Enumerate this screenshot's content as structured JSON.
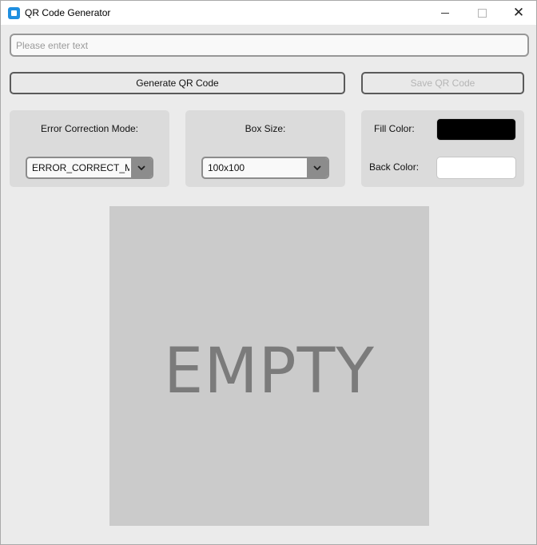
{
  "window": {
    "title": "QR Code Generator",
    "controls": {
      "minimize": "—",
      "maximize": "☐",
      "close": "✕"
    }
  },
  "input": {
    "value": "",
    "placeholder": "Please enter text"
  },
  "buttons": {
    "generate": "Generate QR Code",
    "save": "Save QR Code"
  },
  "error_correction": {
    "label": "Error Correction Mode:",
    "selected": "ERROR_CORRECT_M"
  },
  "box_size": {
    "label": "Box Size:",
    "selected": "100x100"
  },
  "colors": {
    "fill_label": "Fill Color:",
    "fill_value": "#000000",
    "back_label": "Back Color:",
    "back_value": "#ffffff"
  },
  "preview": {
    "placeholder_text": "EMPTY"
  }
}
